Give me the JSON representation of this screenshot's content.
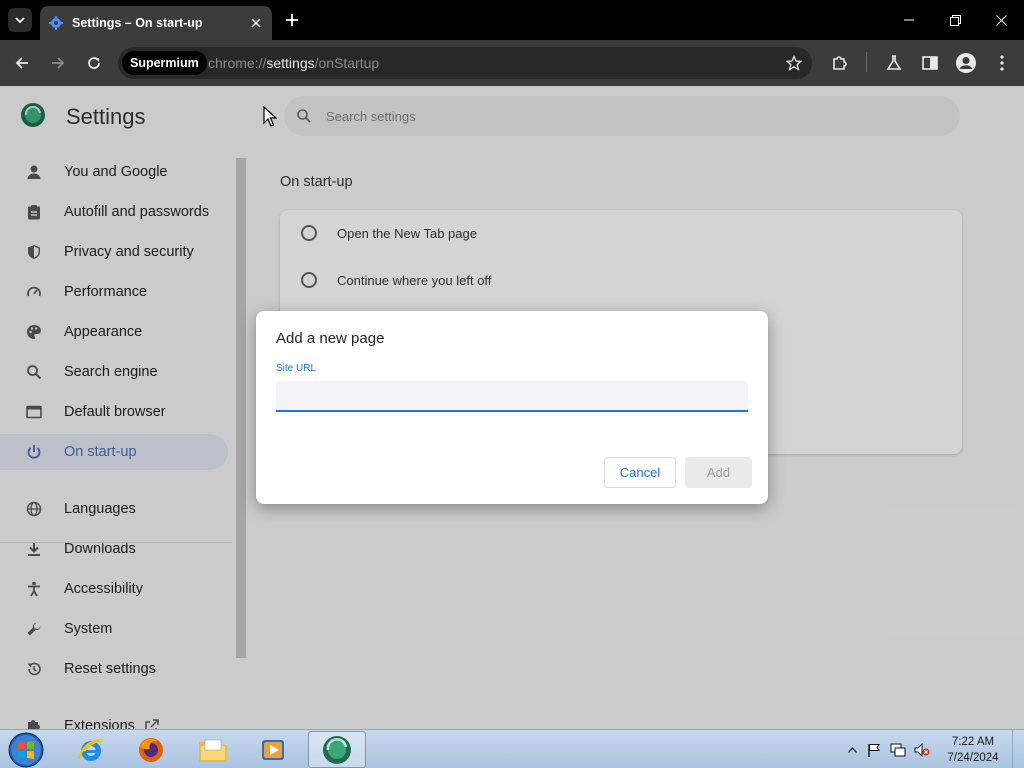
{
  "browser": {
    "tab_title": "Settings – On start-up",
    "omnibox": {
      "chip": "Supermium",
      "url_prefix": "chrome://",
      "url_highlight": "settings",
      "url_suffix": "/onStartup"
    },
    "icons": [
      "tab-search-icon",
      "settings-gear-favicon",
      "close-tab-icon",
      "new-tab-icon",
      "minimize-icon",
      "restore-icon",
      "close-window-icon",
      "back-icon",
      "forward-icon",
      "reload-icon",
      "star-icon",
      "extensions-icon",
      "labs-flask-icon",
      "side-panel-icon",
      "profile-icon",
      "menu-icon"
    ]
  },
  "settings": {
    "title": "Settings",
    "search_placeholder": "Search settings",
    "sidebar": [
      {
        "label": "You and Google",
        "icon": "person-icon"
      },
      {
        "label": "Autofill and passwords",
        "icon": "clipboard-icon"
      },
      {
        "label": "Privacy and security",
        "icon": "shield-icon"
      },
      {
        "label": "Performance",
        "icon": "speedometer-icon"
      },
      {
        "label": "Appearance",
        "icon": "palette-icon"
      },
      {
        "label": "Search engine",
        "icon": "search-icon"
      },
      {
        "label": "Default browser",
        "icon": "browser-window-icon"
      },
      {
        "label": "On start-up",
        "icon": "power-icon",
        "active": true
      },
      {
        "label": "Languages",
        "icon": "globe-icon"
      },
      {
        "label": "Downloads",
        "icon": "download-icon"
      },
      {
        "label": "Accessibility",
        "icon": "accessibility-icon"
      },
      {
        "label": "System",
        "icon": "wrench-icon"
      },
      {
        "label": "Reset settings",
        "icon": "reset-history-icon"
      },
      {
        "label": "Extensions",
        "icon": "puzzle-icon"
      }
    ],
    "section_title": "On start-up",
    "options": [
      {
        "label": "Open the New Tab page"
      },
      {
        "label": "Continue where you left off"
      }
    ]
  },
  "dialog": {
    "title": "Add a new page",
    "field_label": "Site URL",
    "field_value": "",
    "cancel_label": "Cancel",
    "add_label": "Add"
  },
  "taskbar": {
    "apps": [
      "internet-explorer-icon",
      "firefox-icon",
      "file-explorer-icon",
      "media-player-icon",
      "supermium-icon"
    ],
    "time": "7:22 AM",
    "date": "7/24/2024"
  },
  "colors": {
    "accent": "#1a73e8",
    "active_nav_bg": "#d5dbe6",
    "titlebar": "#000000",
    "toolbar": "#3c3c3c"
  }
}
